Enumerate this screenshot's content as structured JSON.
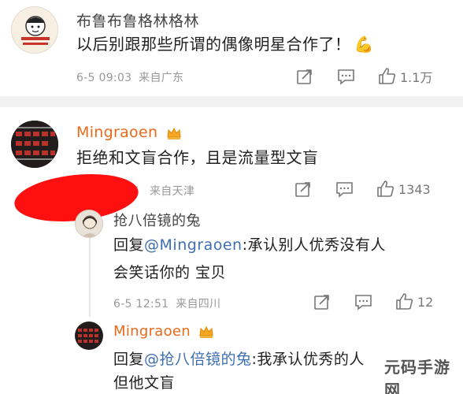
{
  "comment1": {
    "username": "布鲁布鲁格林格林",
    "text": "以后别跟那些所谓的偶像明星合作了！",
    "emoji": "💪",
    "time": "6-5 09:03",
    "location": "来自广东",
    "likes": "1.1万"
  },
  "comment2": {
    "username": "Mingraoen",
    "text": "拒绝和文盲合作，且是流量型文盲",
    "time_partial": "5",
    "location": "来自天津",
    "likes": "1343"
  },
  "reply1": {
    "username": "抢八倍镜的兔",
    "prefix": "回复",
    "mention": "@Mingraoen",
    "text_line1": ":承认别人优秀没有人",
    "text_line2": "会笑话你的  宝贝",
    "time": "6-5 12:51",
    "location": "来自四川",
    "likes": "12"
  },
  "reply2": {
    "username": "Mingraoen",
    "prefix": "回复",
    "mention": "@抢八倍镜的兔",
    "text_line1": ":我承认优秀的人",
    "text_line2": "但他文盲"
  },
  "watermark": "元码手游网",
  "colors": {
    "accent_orange": "#e86a1a",
    "mention_blue": "#3e6fb0",
    "meta_gray": "#999999"
  }
}
